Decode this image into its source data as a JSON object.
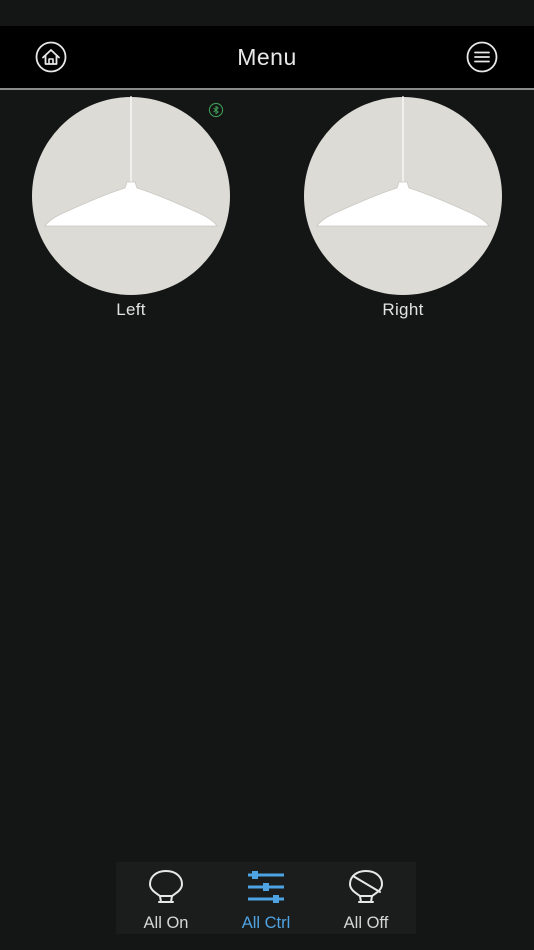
{
  "nav": {
    "title": "Menu"
  },
  "lamps": [
    {
      "label": "Left",
      "bluetooth_connected": true
    },
    {
      "label": "Right",
      "bluetooth_connected": false
    }
  ],
  "tab_bar": {
    "items": [
      {
        "label": "All On",
        "icon": "bulb-on-icon",
        "active": false
      },
      {
        "label": "All Ctrl",
        "icon": "sliders-icon",
        "active": true
      },
      {
        "label": "All Off",
        "icon": "bulb-off-icon",
        "active": false
      }
    ]
  },
  "colors": {
    "background": "#141515",
    "nav_background": "#000000",
    "accent": "#4ea3e2",
    "lamp_circle": "#dcdbd6",
    "bluetooth_indicator": "#3f9a55"
  }
}
